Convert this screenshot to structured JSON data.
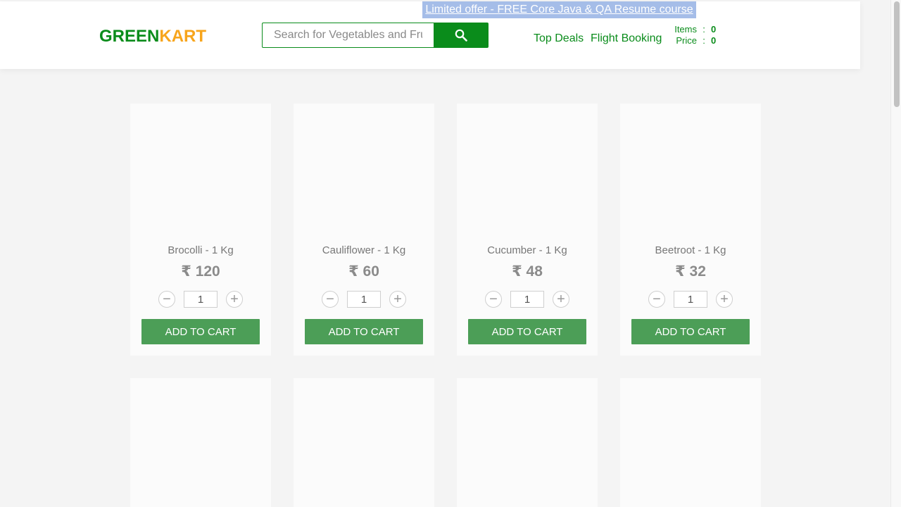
{
  "brand": {
    "part1": "GREEN",
    "part2": "KART",
    "color1": "#0a8c1b",
    "color2": "#f7a51c"
  },
  "search": {
    "placeholder": "Search for Vegetables and Fruits",
    "icon": "search-icon"
  },
  "offer": {
    "text": "Limited offer - FREE Core Java & QA Resume course"
  },
  "nav": {
    "top_deals": "Top Deals",
    "flight_booking": "Flight Booking"
  },
  "cart": {
    "items_label": "Items",
    "items_value": "0",
    "price_label": "Price",
    "price_value": "0",
    "separator": ":"
  },
  "products": [
    {
      "name": "Brocolli - 1 Kg",
      "price": "₹ 120",
      "qty": "1",
      "button": "ADD TO CART"
    },
    {
      "name": "Cauliflower - 1 Kg",
      "price": "₹ 60",
      "qty": "1",
      "button": "ADD TO CART"
    },
    {
      "name": "Cucumber - 1 Kg",
      "price": "₹ 48",
      "qty": "1",
      "button": "ADD TO CART"
    },
    {
      "name": "Beetroot - 1 Kg",
      "price": "₹ 32",
      "qty": "1",
      "button": "ADD TO CART"
    }
  ],
  "stepper": {
    "minus": "−",
    "plus": "+"
  },
  "colors": {
    "accent": "#0a8c1b",
    "button": "#4c9e57",
    "background": "#f4f4f4"
  }
}
